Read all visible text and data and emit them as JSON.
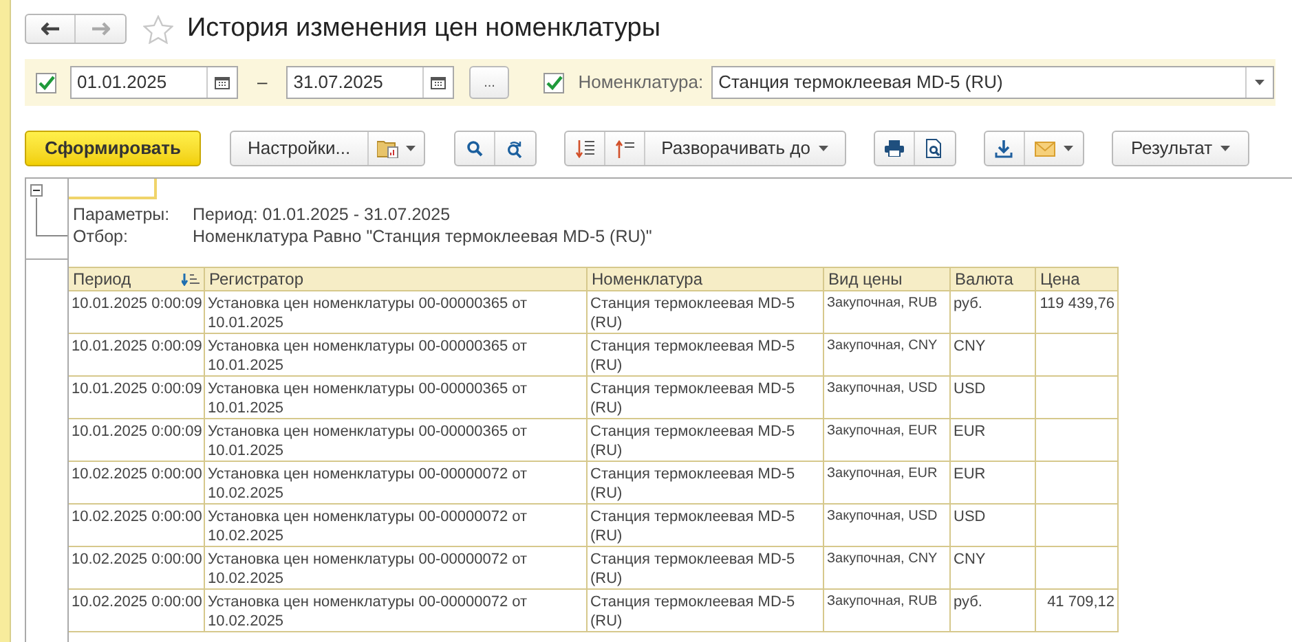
{
  "window": {
    "title": "История изменения цен номенклатуры",
    "favorite": false
  },
  "filter": {
    "period_enabled": true,
    "date_from": "01.01.2025",
    "separator": "–",
    "date_to": "31.07.2025",
    "more_button": "...",
    "item_enabled": true,
    "item_label": "Номенклатура:",
    "item_value": "Станция термоклеевая MD-5 (RU)"
  },
  "toolbar": {
    "generate": "Сформировать",
    "settings": "Настройки...",
    "expand_to": "Разворачивать до",
    "result": "Результат"
  },
  "report": {
    "parameters": [
      {
        "label": "Параметры:",
        "value": "Период: 01.01.2025 - 31.07.2025"
      },
      {
        "label": "Отбор:",
        "value": "Номенклатура Равно \"Станция термоклеевая MD-5 (RU)\""
      }
    ],
    "table": {
      "columns": [
        "Период",
        "Регистратор",
        "Номенклатура",
        "Вид цены",
        "Валюта",
        "Цена"
      ],
      "rows": [
        [
          "10.01.2025 0:00:09",
          "Установка цен номенклатуры 00-00000365 от 10.01.2025",
          "Станция термоклеевая MD-5 (RU)",
          "Закупочная, RUB",
          "руб.",
          "119 439,76"
        ],
        [
          "10.01.2025 0:00:09",
          "Установка цен номенклатуры 00-00000365 от 10.01.2025",
          "Станция термоклеевая MD-5 (RU)",
          "Закупочная, CNY",
          "CNY",
          ""
        ],
        [
          "10.01.2025 0:00:09",
          "Установка цен номенклатуры 00-00000365 от 10.01.2025",
          "Станция термоклеевая MD-5 (RU)",
          "Закупочная, USD",
          "USD",
          ""
        ],
        [
          "10.01.2025 0:00:09",
          "Установка цен номенклатуры 00-00000365 от 10.01.2025",
          "Станция термоклеевая MD-5 (RU)",
          "Закупочная, EUR",
          "EUR",
          ""
        ],
        [
          "10.02.2025 0:00:00",
          "Установка цен номенклатуры 00-00000072 от 10.02.2025",
          "Станция термоклеевая MD-5 (RU)",
          "Закупочная, EUR",
          "EUR",
          ""
        ],
        [
          "10.02.2025 0:00:00",
          "Установка цен номенклатуры 00-00000072 от 10.02.2025",
          "Станция термоклеевая MD-5 (RU)",
          "Закупочная, USD",
          "USD",
          ""
        ],
        [
          "10.02.2025 0:00:00",
          "Установка цен номенклатуры 00-00000072 от 10.02.2025",
          "Станция термоклеевая MD-5 (RU)",
          "Закупочная, CNY",
          "CNY",
          ""
        ],
        [
          "10.02.2025 0:00:00",
          "Установка цен номенклатуры 00-00000072 от 10.02.2025",
          "Станция термоклеевая MD-5 (RU)",
          "Закупочная, RUB",
          "руб.",
          "41 709,12"
        ]
      ]
    }
  }
}
